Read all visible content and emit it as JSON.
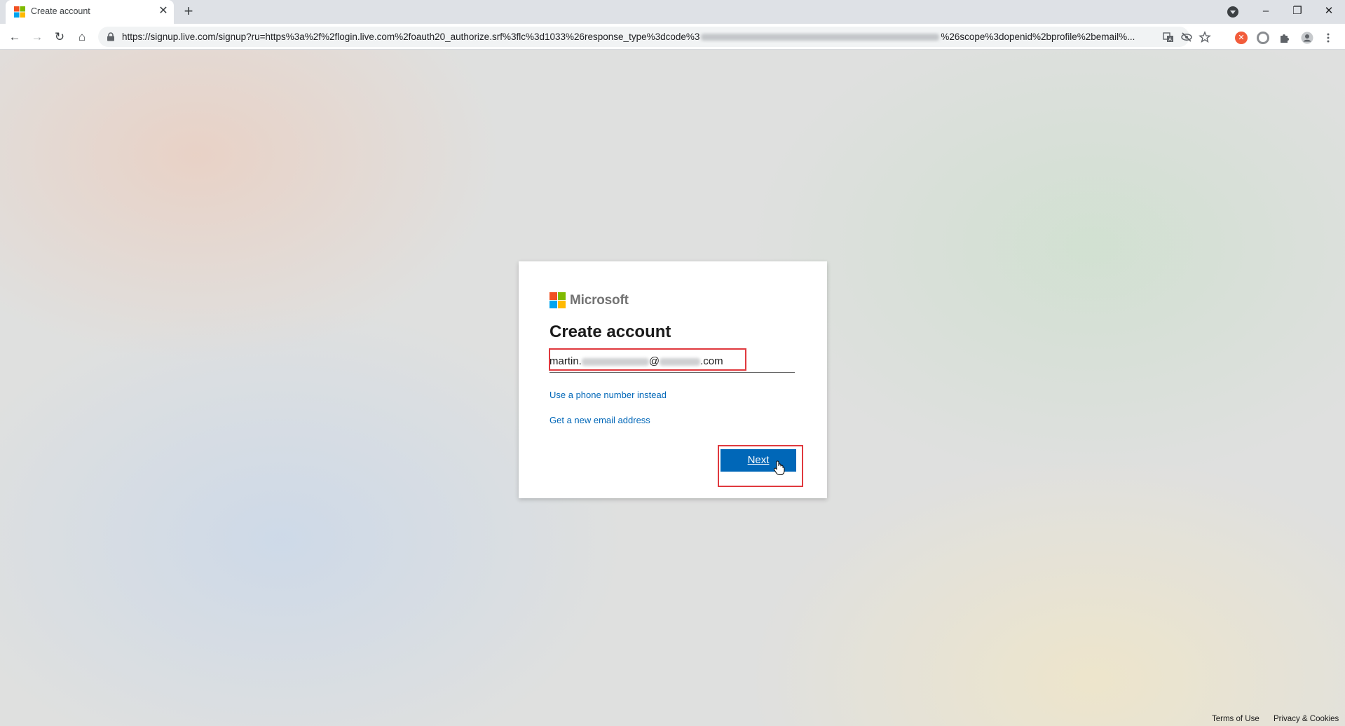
{
  "browser": {
    "tab": {
      "title": "Create account",
      "close_glyph": "✕"
    },
    "new_tab_glyph": "+",
    "window_controls": {
      "minimize": "–",
      "restore": "❐",
      "close": "✕"
    },
    "nav": {
      "back": "←",
      "forward": "→",
      "reload": "↻",
      "home": "⌂"
    },
    "url": {
      "visible_start": "https://signup.live.com/signup?ru=https%3a%2f%2flogin.live.com%2foauth20_authorize.srf%3flc%3d1033%26response_type%3dcode%3",
      "visible_end": "%26scope%3dopenid%2bprofile%2bemail%..."
    },
    "icons": [
      "lock-icon",
      "translate-icon",
      "eye-off-icon",
      "star-icon",
      "extension-red-icon",
      "extension-circle-icon",
      "puzzle-icon",
      "profile-icon",
      "more-icon"
    ]
  },
  "card": {
    "brand": "Microsoft",
    "title": "Create account",
    "email": {
      "prefix": "martin.",
      "at": "@",
      "suffix": ".com"
    },
    "links": {
      "phone": "Use a phone number instead",
      "new_email": "Get a new email address"
    },
    "next_label": "Next"
  },
  "footer": {
    "terms": "Terms of Use",
    "privacy": "Privacy & Cookies"
  },
  "colors": {
    "accent": "#0067b8",
    "highlight": "#e0393e",
    "ms_red": "#f25022",
    "ms_green": "#7fba00",
    "ms_blue": "#00a4ef",
    "ms_yellow": "#ffb900"
  }
}
